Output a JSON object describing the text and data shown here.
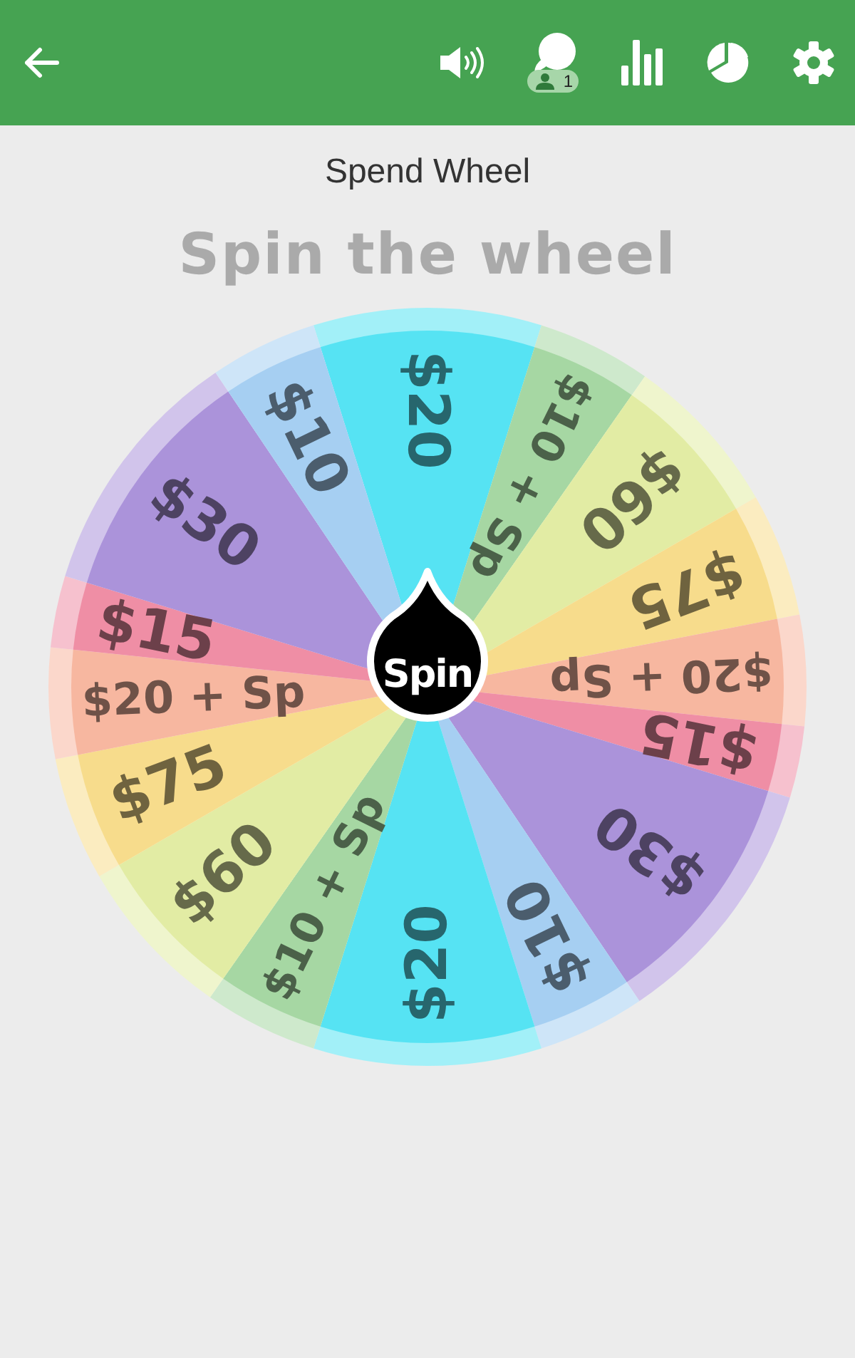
{
  "header": {
    "badge": "1"
  },
  "title": "Spend Wheel",
  "heading": "Spin the wheel",
  "wheel": {
    "segments": [
      {
        "label": "$20",
        "color": "#56e3f3"
      },
      {
        "label": "$10 + Sp",
        "color": "#a6d7a3"
      },
      {
        "label": "$60",
        "color": "#e2eca4"
      },
      {
        "label": "$75",
        "color": "#f7dc8c"
      },
      {
        "label": "$20 + Sp",
        "color": "#f7b7a0"
      },
      {
        "label": "$15",
        "color": "#ef8ea5"
      },
      {
        "label": "$30",
        "color": "#ab93da"
      },
      {
        "label": "$10",
        "color": "#a6cff2"
      },
      {
        "label": "$20",
        "color": "#56e3f3"
      },
      {
        "label": "$10 + Sp",
        "color": "#a6d7a3"
      },
      {
        "label": "$60",
        "color": "#e2eca4"
      },
      {
        "label": "$75",
        "color": "#f7dc8c"
      },
      {
        "label": "$20 + Sp",
        "color": "#f7b7a0"
      },
      {
        "label": "$15",
        "color": "#ef8ea5"
      },
      {
        "label": "$30",
        "color": "#ab93da"
      },
      {
        "label": "$10",
        "color": "#a6cff2"
      }
    ]
  },
  "spin_button": "Spin"
}
